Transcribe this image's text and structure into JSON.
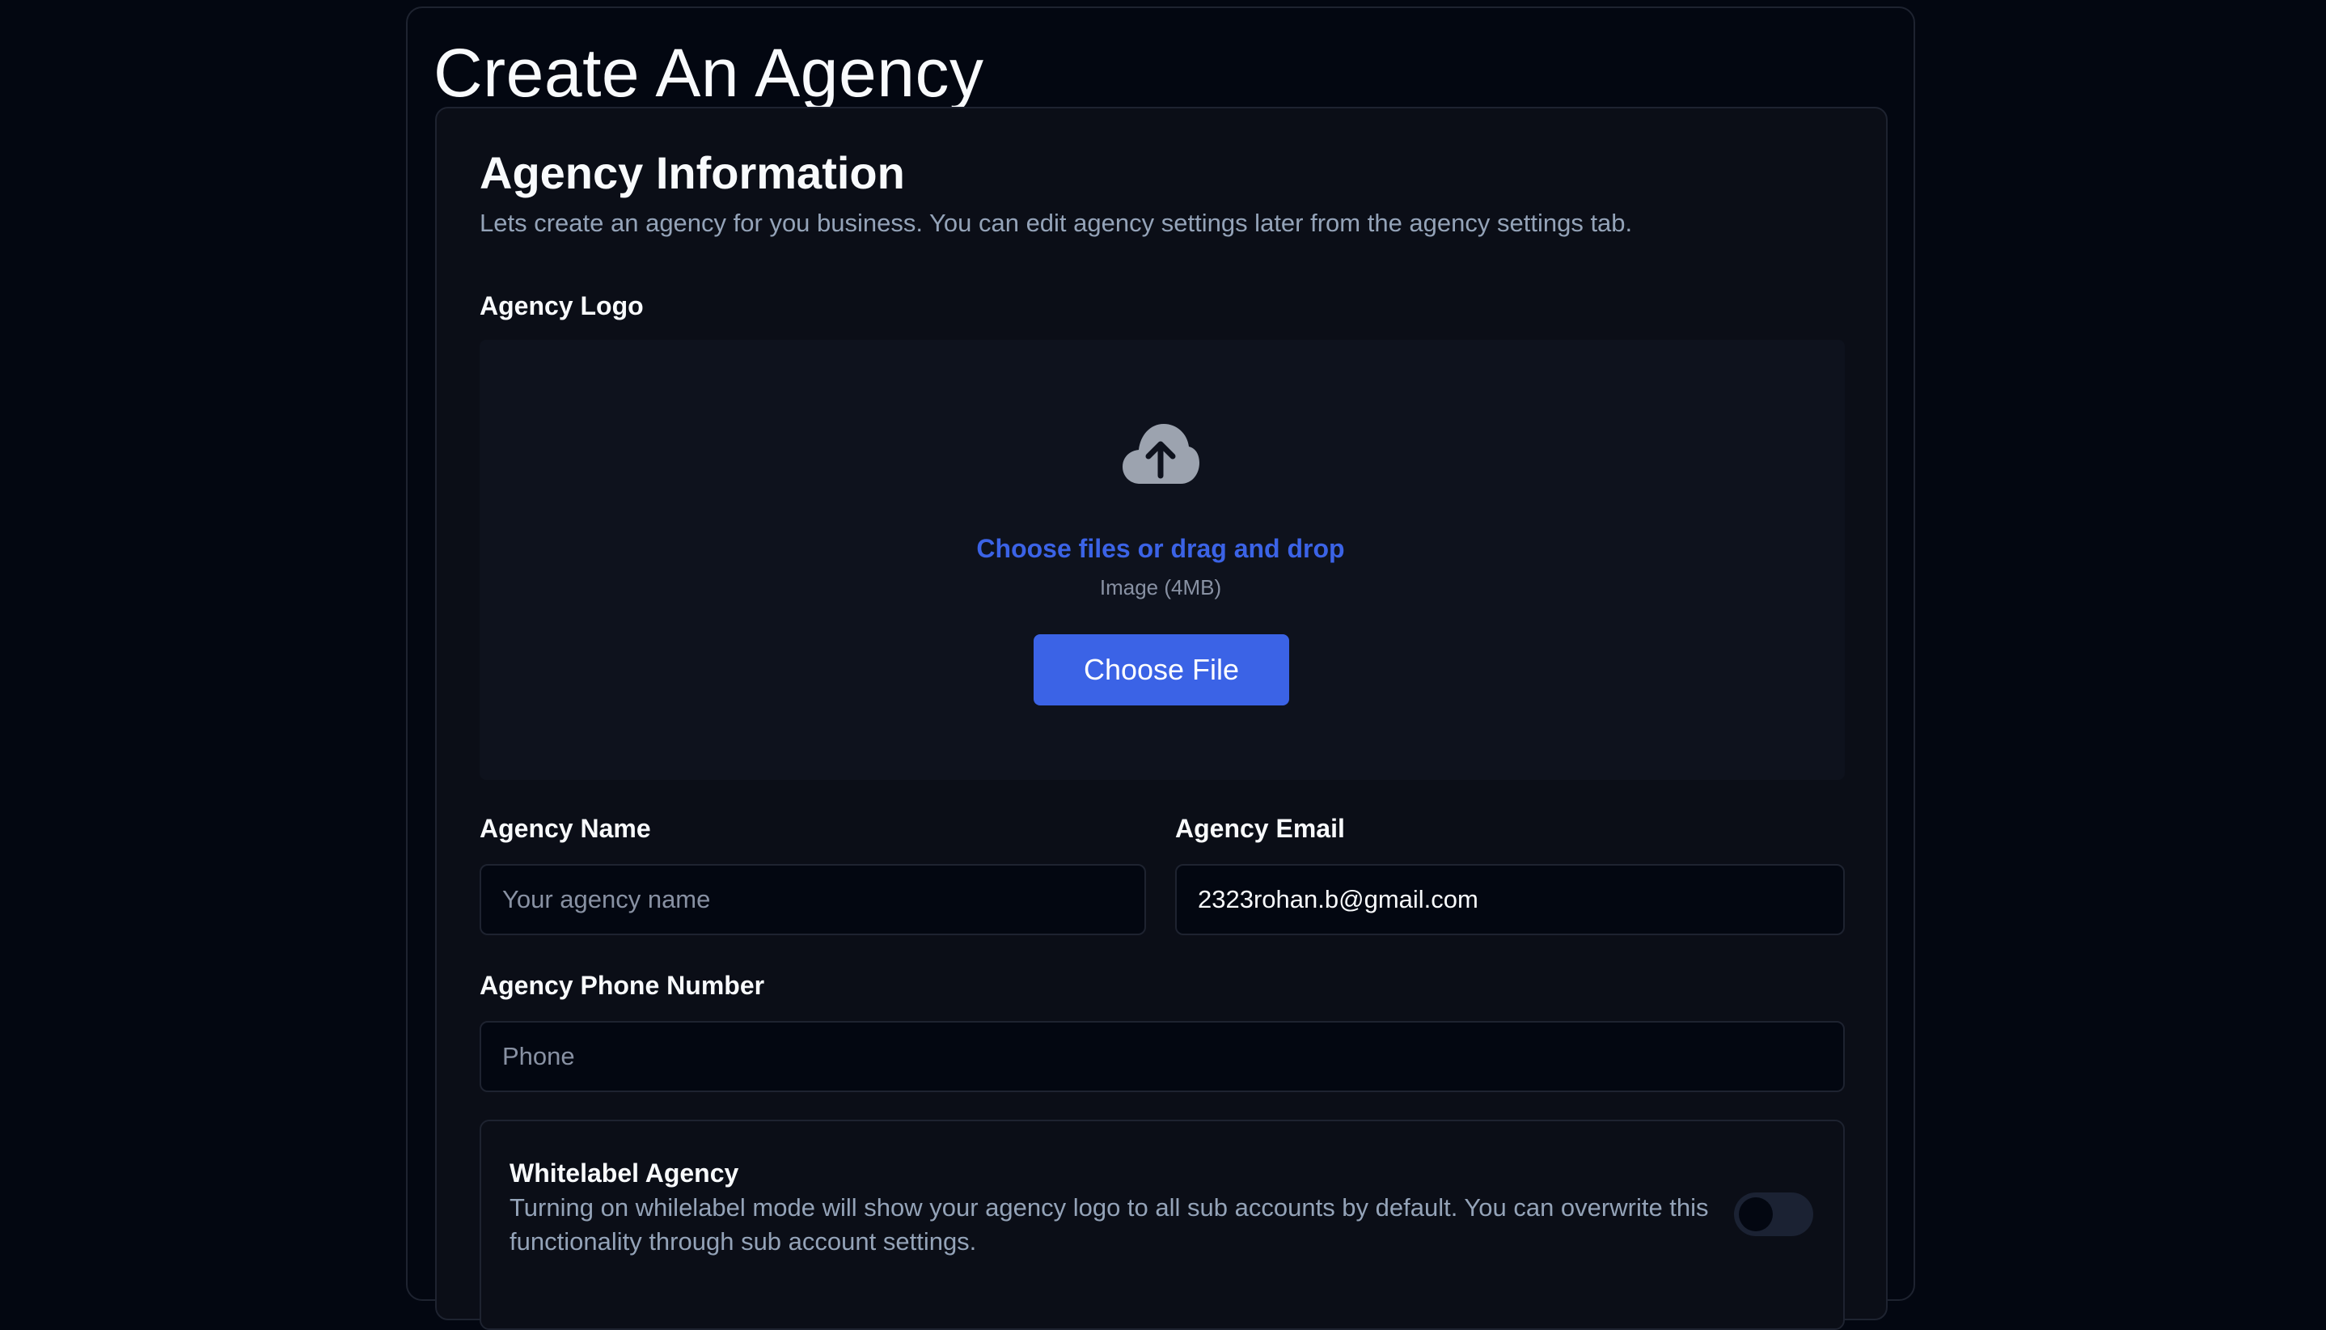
{
  "page": {
    "title": "Create An Agency"
  },
  "card": {
    "title": "Agency Information",
    "description": "Lets create an agency for you business. You can edit agency settings later from the agency settings tab."
  },
  "logo": {
    "label": "Agency Logo",
    "upload_icon": "cloud-upload-icon",
    "dropzone_text": "Choose files or drag and drop",
    "hint": "Image (4MB)",
    "button_label": "Choose File"
  },
  "name_field": {
    "label": "Agency Name",
    "value": "",
    "placeholder": "Your agency name"
  },
  "email_field": {
    "label": "Agency Email",
    "value": "2323rohan.b@gmail.com",
    "placeholder": ""
  },
  "phone_field": {
    "label": "Agency Phone Number",
    "value": "",
    "placeholder": "Phone"
  },
  "whitelabel": {
    "title": "Whitelabel Agency",
    "description": "Turning on whilelabel mode will show your agency logo to all sub accounts by default. You can overwrite this functionality through sub account settings.",
    "enabled": false
  },
  "colors": {
    "background": "#030711",
    "card": "#0b0e17",
    "accent": "#3b63e6",
    "muted_text": "#94a3b8"
  }
}
